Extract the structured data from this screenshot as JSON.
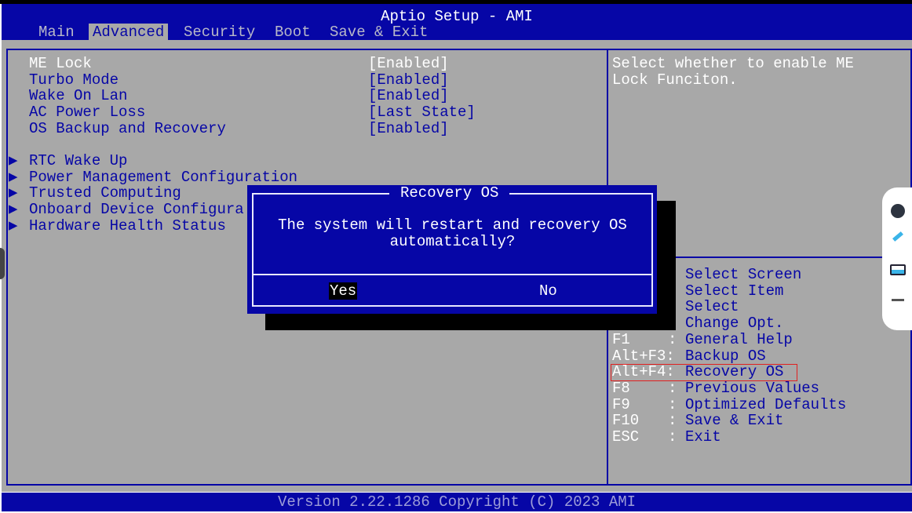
{
  "header": {
    "title": "Aptio Setup - AMI",
    "tabs": [
      {
        "label": "Main"
      },
      {
        "label": "Advanced",
        "active": true
      },
      {
        "label": "Security"
      },
      {
        "label": "Boot"
      },
      {
        "label": "Save & Exit"
      }
    ]
  },
  "settings": [
    {
      "label": "ME Lock",
      "value": "[Enabled]",
      "selected": true
    },
    {
      "label": "Turbo Mode",
      "value": "[Enabled]"
    },
    {
      "label": "Wake On Lan",
      "value": "[Enabled]"
    },
    {
      "label": "AC Power Loss",
      "value": "[Last State]"
    },
    {
      "label": "OS Backup and Recovery",
      "value": "[Enabled]"
    }
  ],
  "submenus": [
    {
      "label": "RTC Wake Up"
    },
    {
      "label": "Power Management Configuration"
    },
    {
      "label": "Trusted Computing"
    },
    {
      "label": "Onboard Device Configura"
    },
    {
      "label": "Hardware Health Status"
    }
  ],
  "submenu_marker": "▶",
  "help": {
    "text_line1": "Select whether to enable ME",
    "text_line2": "Lock Funciton."
  },
  "keys": [
    {
      "key": "",
      "sep": "",
      "desc": "Select Screen"
    },
    {
      "key": "",
      "sep": "",
      "desc": "Select Item"
    },
    {
      "key": "",
      "sep": "",
      "desc": "Select"
    },
    {
      "key": "",
      "sep": "",
      "desc": "Change Opt."
    },
    {
      "key": "F1",
      "sep": ":",
      "desc": "General Help"
    },
    {
      "key": "Alt+F3:",
      "sep": "",
      "desc": "Backup OS"
    },
    {
      "key": "Alt+F4:",
      "sep": "",
      "desc": "Recovery OS",
      "highlighted": true
    },
    {
      "key": "F8",
      "sep": ":",
      "desc": "Previous Values"
    },
    {
      "key": "F9",
      "sep": ":",
      "desc": "Optimized Defaults"
    },
    {
      "key": "F10",
      "sep": ":",
      "desc": "Save & Exit"
    },
    {
      "key": "ESC",
      "sep": ":",
      "desc": "Exit"
    }
  ],
  "dialog": {
    "title": "Recovery OS",
    "message": "The system will restart and recovery OS\nautomatically?",
    "yes": "Yes",
    "no": "No",
    "focused": "Yes"
  },
  "footer": "Version 2.22.1286 Copyright (C) 2023 AMI",
  "colors": {
    "bios_blue": "#0606a6",
    "bios_gray": "#a8a8a8",
    "highlight_box": "#e02020"
  }
}
